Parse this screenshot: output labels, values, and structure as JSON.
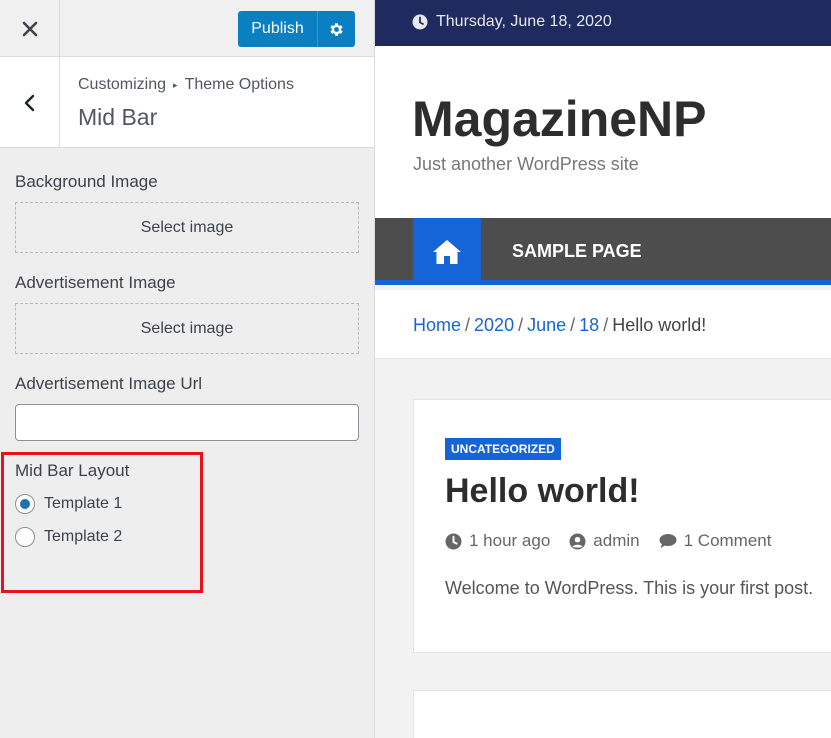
{
  "customizer": {
    "publish_label": "Publish",
    "breadcrumb_root": "Customizing",
    "breadcrumb_separator": "▸",
    "breadcrumb_parent": "Theme Options",
    "section_title": "Mid Bar",
    "background_image_label": "Background Image",
    "background_image_button": "Select image",
    "advertisement_image_label": "Advertisement Image",
    "advertisement_image_button": "Select image",
    "advertisement_url_label": "Advertisement Image Url",
    "advertisement_url_value": "",
    "layout_label": "Mid Bar Layout",
    "layout_options": [
      {
        "label": "Template 1",
        "checked": true
      },
      {
        "label": "Template 2",
        "checked": false
      }
    ]
  },
  "preview": {
    "date": "Thursday, June 18, 2020",
    "site_title": "MagazineNP",
    "tagline": "Just another WordPress site",
    "nav_item": "SAMPLE PAGE",
    "breadcrumbs": {
      "home": "Home",
      "year": "2020",
      "month": "June",
      "day": "18",
      "current": "Hello world!",
      "separator": "/"
    },
    "post": {
      "category": "UNCATEGORIZED",
      "title": "Hello world!",
      "time": "1 hour ago",
      "author": "admin",
      "comments": "1 Comment",
      "excerpt": "Welcome to WordPress. This is your first post."
    }
  },
  "colors": {
    "publish_blue": "#0a7fc2",
    "topbar_navy": "#1f2b5e",
    "accent_blue": "#1565d8",
    "nav_gray": "#4d4d4d",
    "highlight_red": "#e8121b"
  },
  "icons": [
    "close-icon",
    "gear-icon",
    "back-chevron-icon",
    "clock-icon",
    "home-icon",
    "user-icon",
    "comment-icon"
  ]
}
